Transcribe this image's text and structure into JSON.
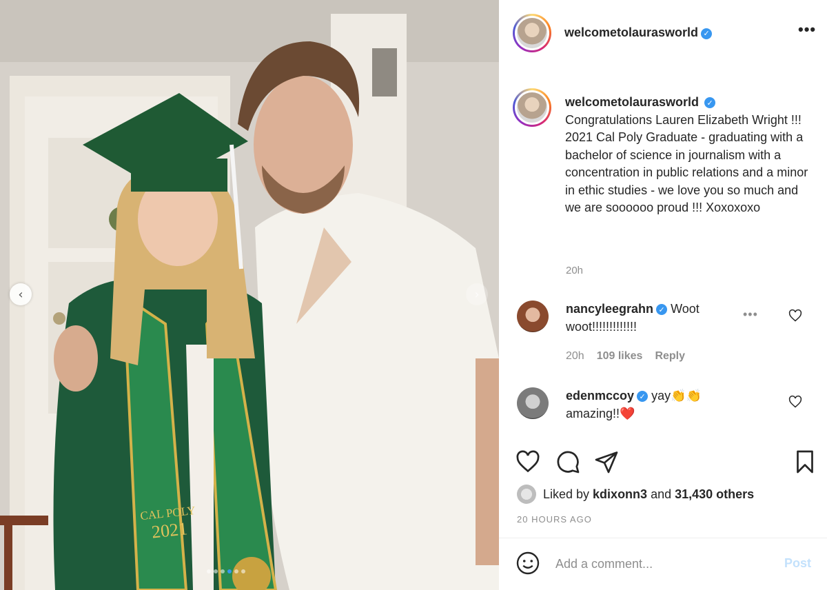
{
  "post": {
    "username": "welcometolaurasworld",
    "more_icon": "more-horizontal-icon",
    "caption": "Congratulations Lauren Elizabeth Wright !!! 2021 Cal Poly Graduate - graduating with a bachelor of science in journalism with a concentration in public relations and a minor in ethic studies - we love you so much and we are soooooo proud !!! Xoxoxoxo",
    "caption_time": "20h",
    "likes_prefix": "Liked by",
    "liked_by_user": "kdixonn3",
    "likes_and": "and",
    "likes_others": "31,430 others",
    "time_ago": "20 HOURS AGO"
  },
  "photo": {
    "stole_text_top": "CAL POLY",
    "stole_text_year": "2021",
    "carousel_dots": 6,
    "active_dot": 4
  },
  "comments": [
    {
      "username": "nancyleegrahn",
      "text": "Woot woot!!!!!!!!!!!!!",
      "time": "20h",
      "likes": "109 likes",
      "reply": "Reply"
    },
    {
      "username": "edenmccoy",
      "text": "yay👏👏 amazing!!❤️"
    }
  ],
  "composer": {
    "placeholder": "Add a comment...",
    "post_label": "Post"
  },
  "colors": {
    "accent": "#3897f0",
    "post_disabled": "#c3e1fc",
    "muted": "#8e8e8e"
  }
}
